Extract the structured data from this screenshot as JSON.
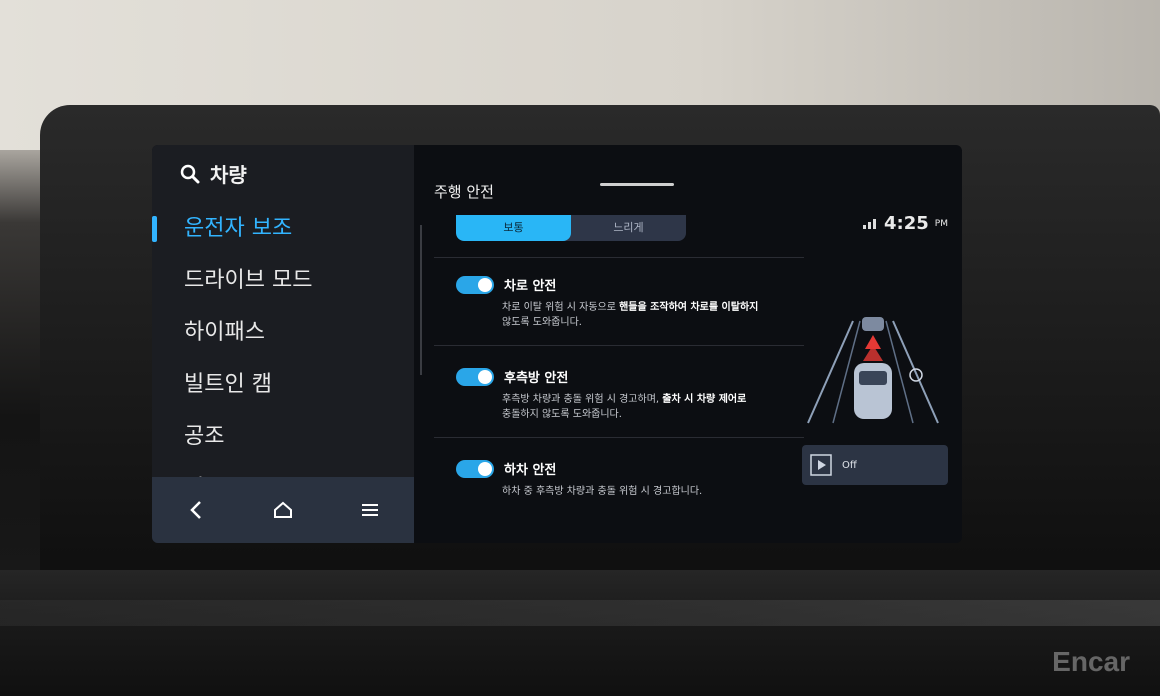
{
  "left_panel": {
    "search_title": "차량",
    "menu": [
      {
        "label": "운전자 보조",
        "active": true
      },
      {
        "label": "드라이브 모드",
        "active": false
      },
      {
        "label": "하이패스",
        "active": false
      },
      {
        "label": "빌트인 캠",
        "active": false
      },
      {
        "label": "공조",
        "active": false
      },
      {
        "label": "시트",
        "active": false
      }
    ]
  },
  "main": {
    "section_title": "주행 안전",
    "segment": {
      "left": "보통",
      "right": "느리게",
      "selected": "보통"
    },
    "status": {
      "time": "4:25",
      "ampm": "PM"
    },
    "items": [
      {
        "title": "차로 안전",
        "enabled": true,
        "desc_plain": "차로 이탈 위험 시 자동으로 ",
        "desc_bold": "핸들을 조작하여 차로를 이탈하지",
        "desc_tail": "않도록 도와줍니다."
      },
      {
        "title": "후측방 안전",
        "enabled": true,
        "desc_plain": "후측방 차량과 충돌 위험 시 경고하며, ",
        "desc_bold": "출차 시 차량 제어로",
        "desc_tail": "충돌하지 않도록 도와줍니다."
      },
      {
        "title": "하차 안전",
        "enabled": true,
        "desc_plain": "하차 중 후측방 차량과 충돌 위험 시 경고합니다.",
        "desc_bold": "",
        "desc_tail": ""
      }
    ],
    "preview": {
      "off_label": "Off"
    }
  },
  "watermark": "Encar",
  "colors": {
    "accent": "#32b4ff",
    "toggle_on": "#2aa6e8",
    "warning": "#e53935"
  }
}
